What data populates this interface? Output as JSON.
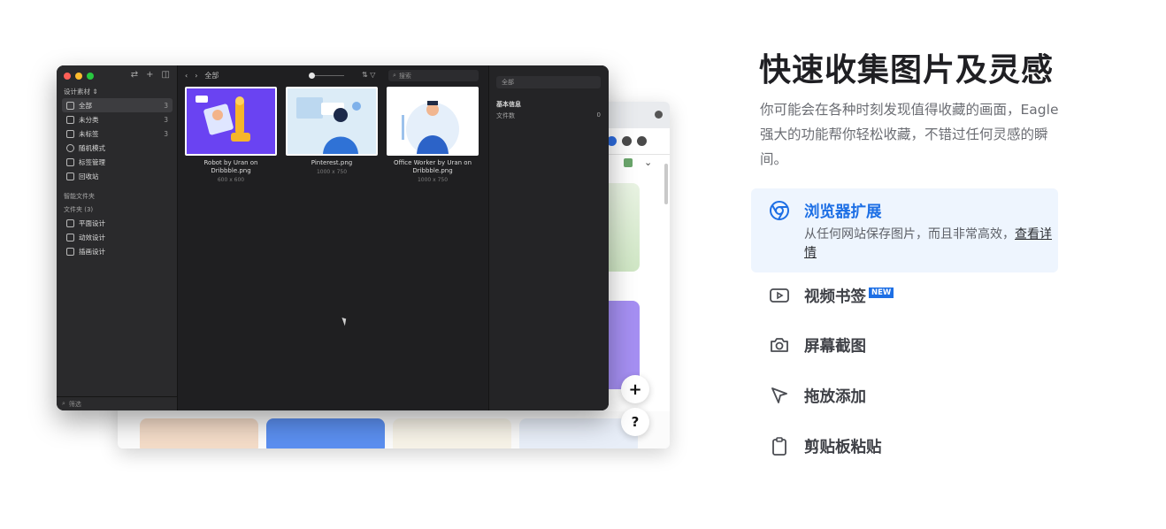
{
  "app": {
    "library_name": "设计素材 ⇕",
    "nav": [
      {
        "label": "全部",
        "count": "3"
      },
      {
        "label": "未分类",
        "count": "3"
      },
      {
        "label": "未标签",
        "count": "3"
      },
      {
        "label": "随机模式",
        "count": ""
      },
      {
        "label": "标签管理",
        "count": ""
      },
      {
        "label": "回收站",
        "count": ""
      }
    ],
    "smart_folders_label": "智能文件夹",
    "folders_label": "文件夹 (3)",
    "folders": [
      "平面设计",
      "动效设计",
      "插画设计"
    ],
    "filter_placeholder": "筛选",
    "topbar_title": "全部",
    "search_placeholder": "搜索",
    "items": [
      {
        "name": "Robot by Uran on Dribbble.png",
        "dims": "600 x 600"
      },
      {
        "name": "Pinterest.png",
        "dims": "1000 x 750"
      },
      {
        "name": "Office Worker by Uran on Dribbble.png",
        "dims": "1000 x 750"
      }
    ],
    "inspector": {
      "field_value": "全部",
      "section_title": "基本信息",
      "row_label": "文件数",
      "row_value": "0"
    }
  },
  "browser": {
    "fab_add": "+",
    "fab_help": "?"
  },
  "panel": {
    "title": "快速收集图片及灵感",
    "description": "你可能会在各种时刻发现值得收藏的画面，Eagle 强大的功能帮你轻松收藏，不错过任何灵感的瞬间。",
    "features": [
      {
        "label": "浏览器扩展",
        "icon": "chrome-icon",
        "active": true,
        "sub": "从任何网站保存图片，而且非常高效，",
        "more": "查看详情"
      },
      {
        "label": "视频书签",
        "icon": "play-video-icon",
        "badge": "NEW"
      },
      {
        "label": "屏幕截图",
        "icon": "camera-icon"
      },
      {
        "label": "拖放添加",
        "icon": "cursor-arrow-icon"
      },
      {
        "label": "剪贴板粘贴",
        "icon": "clipboard-icon"
      }
    ],
    "accent_color": "#1d6fe5"
  }
}
